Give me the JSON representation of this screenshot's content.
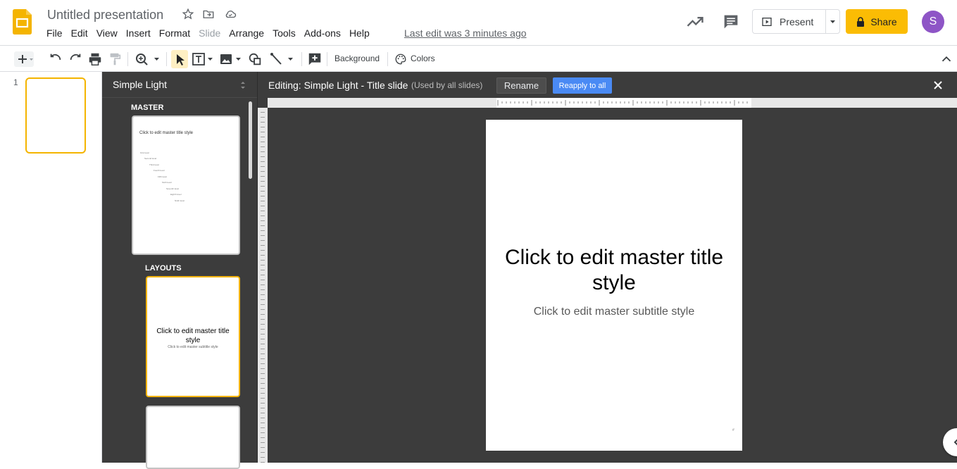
{
  "header": {
    "doc_title": "Untitled presentation",
    "menus": [
      "File",
      "Edit",
      "View",
      "Insert",
      "Format",
      "Slide",
      "Arrange",
      "Tools",
      "Add-ons",
      "Help"
    ],
    "last_edit": "Last edit was 3 minutes ago",
    "present_label": "Present",
    "share_label": "Share",
    "avatar_initial": "S",
    "share_color": "#fbbc04",
    "avatar_color": "#8e55c6"
  },
  "toolbar": {
    "background_label": "Background",
    "colors_label": "Colors"
  },
  "filmstrip": {
    "slide_number": "1"
  },
  "theme_panel": {
    "theme_name": "Simple Light",
    "master_label": "MASTER",
    "layouts_label": "LAYOUTS",
    "master_thumb_title": "Click to edit master title style",
    "master_thumb_levels": [
      "First level",
      "Second level",
      "Third level",
      "Fourth level",
      "Fifth level",
      "Sixth level",
      "Seventh level",
      "Eighth level",
      "Ninth level"
    ],
    "layout1_title": "Click to edit master title style",
    "layout1_subtitle": "Click to edit master subtitle style"
  },
  "editor": {
    "editing_title": "Editing: Simple Light - Title slide",
    "used_by": "(Used by all slides)",
    "rename_label": "Rename",
    "reapply_label": "Reapply to all",
    "reapply_color": "#4a8af4",
    "slide_title": "Click to edit master title style",
    "slide_subtitle": "Click to edit master subtitle style",
    "slide_number_placeholder": "#"
  }
}
